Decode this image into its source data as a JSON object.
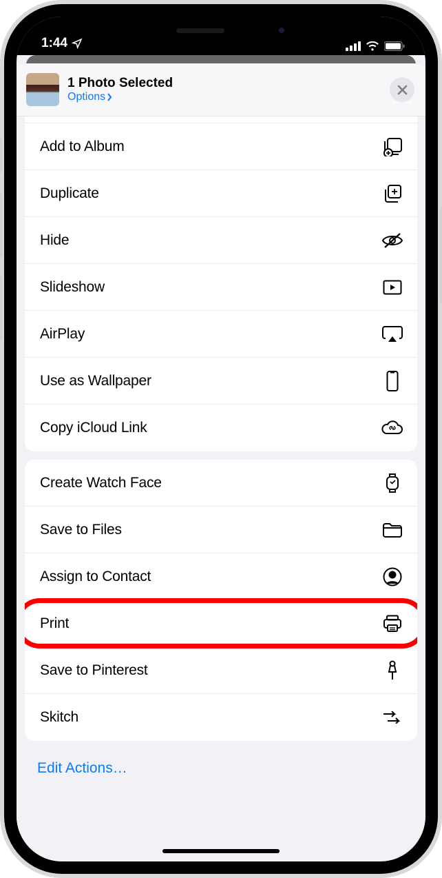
{
  "status": {
    "time": "1:44"
  },
  "header": {
    "title": "1 Photo Selected",
    "options_label": "Options"
  },
  "groups": [
    {
      "items": [
        {
          "label": "Add to Album",
          "icon": "add-to-album-icon"
        },
        {
          "label": "Duplicate",
          "icon": "duplicate-icon"
        },
        {
          "label": "Hide",
          "icon": "hide-icon"
        },
        {
          "label": "Slideshow",
          "icon": "slideshow-icon"
        },
        {
          "label": "AirPlay",
          "icon": "airplay-icon"
        },
        {
          "label": "Use as Wallpaper",
          "icon": "wallpaper-icon"
        },
        {
          "label": "Copy iCloud Link",
          "icon": "icloud-link-icon"
        }
      ]
    },
    {
      "items": [
        {
          "label": "Create Watch Face",
          "icon": "watchface-icon"
        },
        {
          "label": "Save to Files",
          "icon": "folder-icon"
        },
        {
          "label": "Assign to Contact",
          "icon": "contact-icon"
        },
        {
          "label": "Print",
          "icon": "print-icon",
          "highlight": true
        },
        {
          "label": "Save to Pinterest",
          "icon": "pin-icon"
        },
        {
          "label": "Skitch",
          "icon": "skitch-icon"
        }
      ]
    }
  ],
  "footer": {
    "edit_label": "Edit Actions…"
  }
}
